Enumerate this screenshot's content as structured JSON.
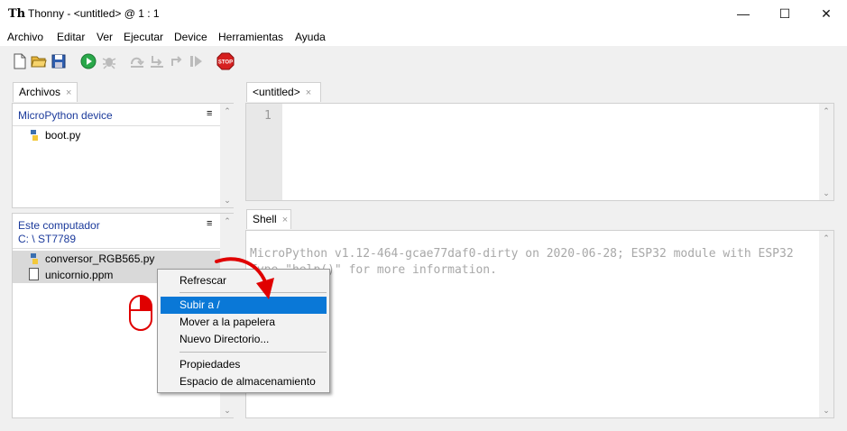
{
  "window": {
    "title": "Thonny  -  <untitled>  @  1 : 1",
    "app_icon": "Th",
    "min_glyph": "—",
    "max_glyph": "☐",
    "close_glyph": "✕"
  },
  "menu": [
    "Archivo",
    "Editar",
    "Ver",
    "Ejecutar",
    "Device",
    "Herramientas",
    "Ayuda"
  ],
  "toolbar": {
    "icons": [
      "new-file-icon",
      "open-folder-icon",
      "save-icon",
      "run-icon",
      "debug-icon",
      "step-over-icon",
      "step-into-icon",
      "step-out-icon",
      "resume-icon",
      "stop-icon"
    ],
    "stop_label": "STOP"
  },
  "files_panel": {
    "tab_label": "Archivos",
    "tab_close": "×",
    "device": {
      "title": "MicroPython device",
      "menu_glyph": "≡",
      "files": [
        "boot.py"
      ]
    },
    "computer": {
      "title": "Este computador",
      "path": "C: \\ ST7789",
      "menu_glyph": "≡",
      "files": [
        "conversor_RGB565.py",
        "unicornio.ppm"
      ]
    }
  },
  "editor": {
    "tab_label": "<untitled>",
    "tab_close": "×",
    "line_numbers": [
      "1"
    ]
  },
  "shell": {
    "tab_label": "Shell",
    "tab_close": "×",
    "lines": [
      "MicroPython v1.12-464-gcae77daf0-dirty on 2020-06-28; ESP32 module with ESP32",
      "Type \"help()\" for more information."
    ]
  },
  "context_menu": {
    "items": [
      "Refrescar",
      "Subir a /",
      "Mover a la papelera",
      "Nuevo Directorio...",
      "Propiedades",
      "Espacio de almacenamiento"
    ],
    "selected": "Subir a /"
  },
  "colors": {
    "accent": "#0a78d7",
    "section_title": "#1b3a9b",
    "annotation": "#e00000"
  }
}
